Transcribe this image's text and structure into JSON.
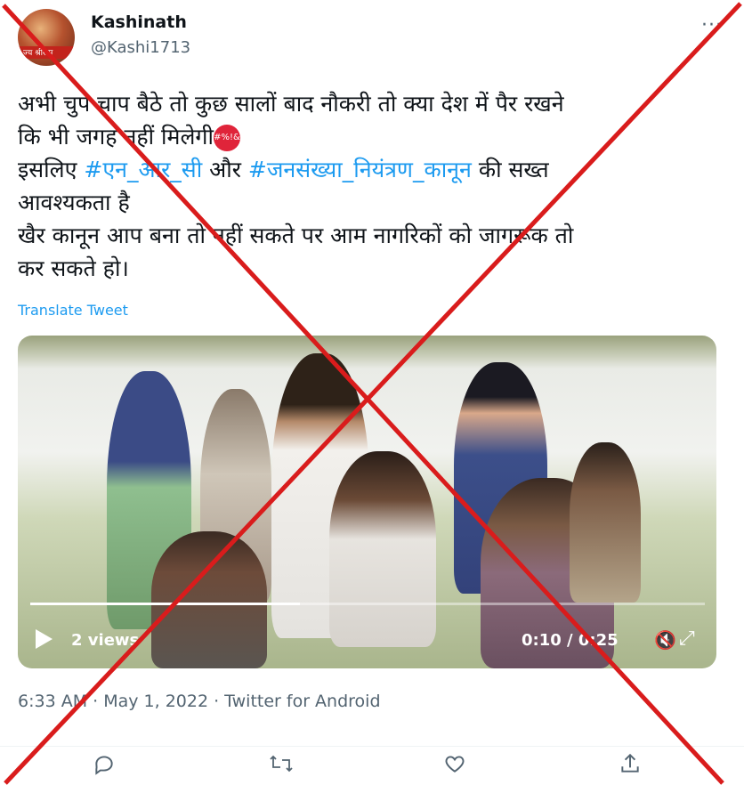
{
  "author": {
    "name": "Kashinath",
    "handle": "@Kashi1713",
    "avatar_text": "ज्य श्रीराम"
  },
  "more_icon": "more-horizontal-icon",
  "tweet": {
    "line1": "अभी चुप चाप बैठे तो कुछ सालों बाद नौकरी तो क्या देश में पैर रखने",
    "line2": "कि भी जगह नहीं मिलेगी",
    "emoji_text": "#%!&",
    "line3_a": "इसलिए ",
    "hashtag1": "#एन_आर_सी",
    "line3_b": " और ",
    "hashtag2": "#जनसंख्या_नियंत्रण_कानून",
    "line3_c": " की सख्त",
    "line4": "आवश्यकता है",
    "line5": "खैर कानून आप बना तो नहीं सकते पर आम नागरिकों को जागरूक तो",
    "line6": "कर सकते हो।"
  },
  "translate_label": "Translate Tweet",
  "video": {
    "views": "2 views",
    "time": "0:10 / 0:25",
    "progress": 0.4
  },
  "meta": "6:33 AM · May 1, 2022 · Twitter for Android",
  "actions": [
    "reply-icon",
    "retweet-icon",
    "like-icon",
    "share-icon"
  ],
  "overlay_color": "#d91c1c"
}
